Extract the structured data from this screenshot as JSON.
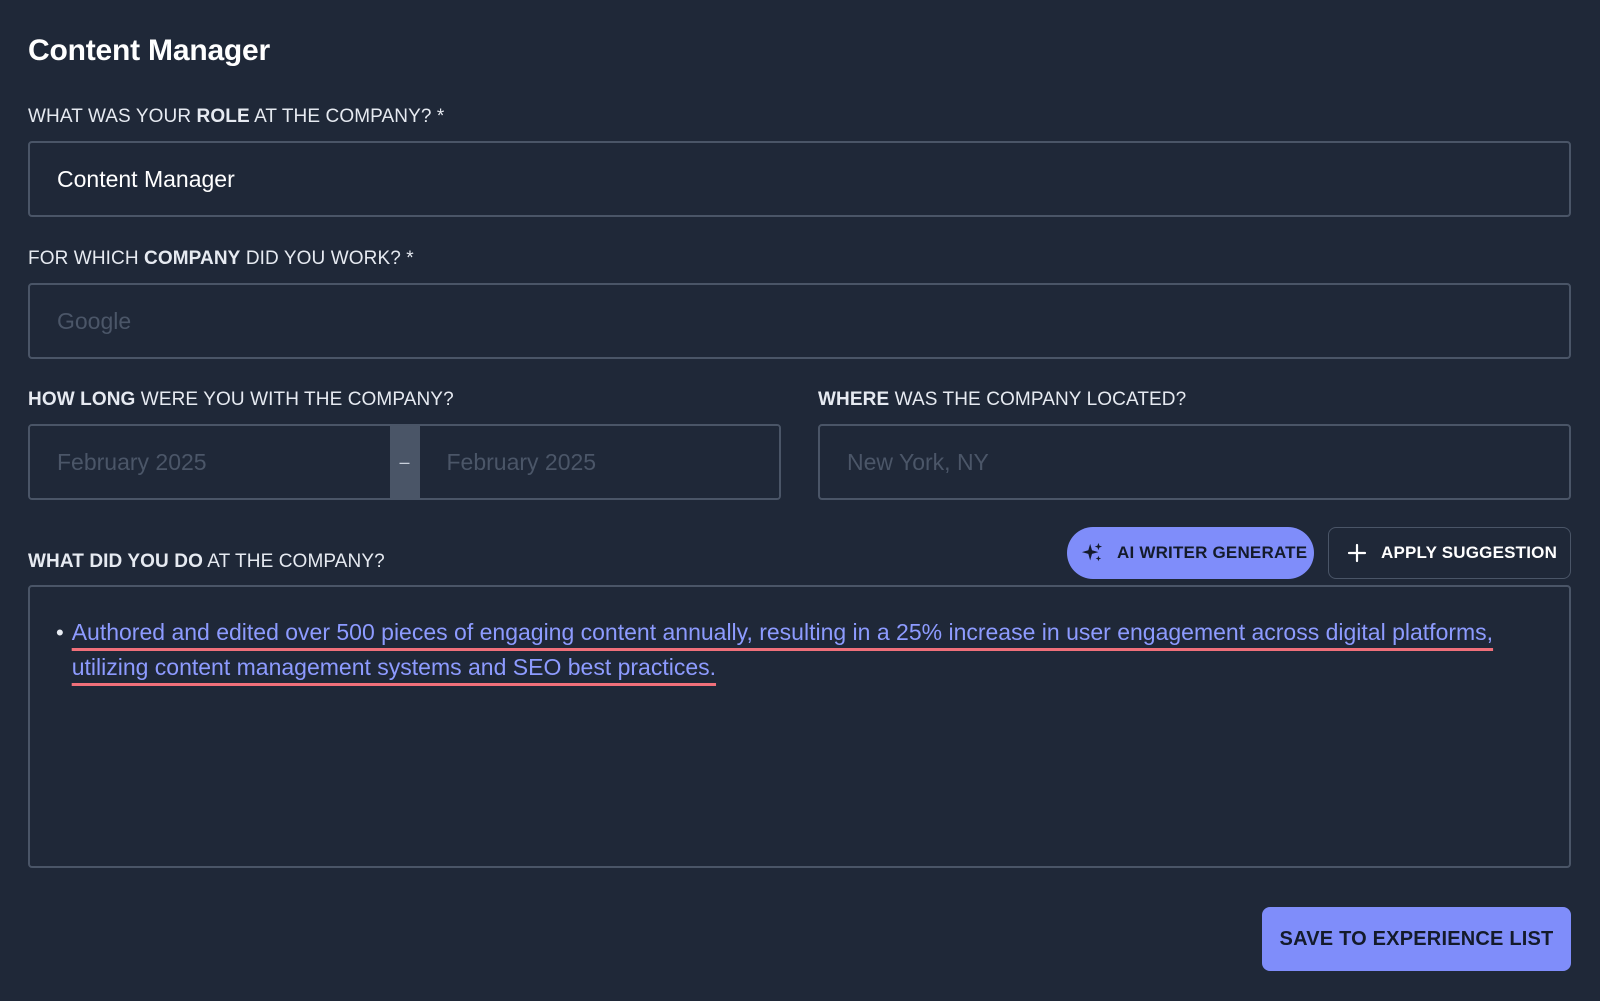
{
  "header": {
    "title": "Content Manager"
  },
  "role": {
    "label_pre": "WHAT WAS YOUR ",
    "label_bold": "ROLE",
    "label_post": " AT THE COMPANY?  *",
    "value": "Content Manager"
  },
  "company": {
    "label_pre": "FOR WHICH ",
    "label_bold": "COMPANY",
    "label_post": " DID YOU WORK?  *",
    "placeholder": "Google"
  },
  "duration": {
    "label_bold": "HOW LONG",
    "label_post": " WERE YOU WITH THE COMPANY?",
    "start_placeholder": "February 2025",
    "separator": "–",
    "end_placeholder": "February 2025"
  },
  "location": {
    "label_bold": "WHERE",
    "label_post": " WAS THE COMPANY LOCATED?",
    "placeholder": "New York, NY"
  },
  "duties": {
    "label_bold": "WHAT DID YOU DO",
    "label_post": " AT THE COMPANY?",
    "ai_button": "AI WRITER GENERATE",
    "apply_button": "APPLY SUGGESTION",
    "bullets": [
      "Authored and edited over 500 pieces of engaging content annually, resulting in a 25% increase in user engagement across digital platforms, utilizing content management systems and SEO best practices."
    ]
  },
  "footer": {
    "save_button": "SAVE TO EXPERIENCE LIST"
  },
  "colors": {
    "background": "#1f2838",
    "accent": "#7f8dfa",
    "suggestion_text": "#8d9bff",
    "spellcheck_underline": "#f0707a",
    "border": "#4a5567"
  },
  "icons": {
    "ai_button": "sparkle-icon",
    "apply_button": "plus-icon"
  }
}
